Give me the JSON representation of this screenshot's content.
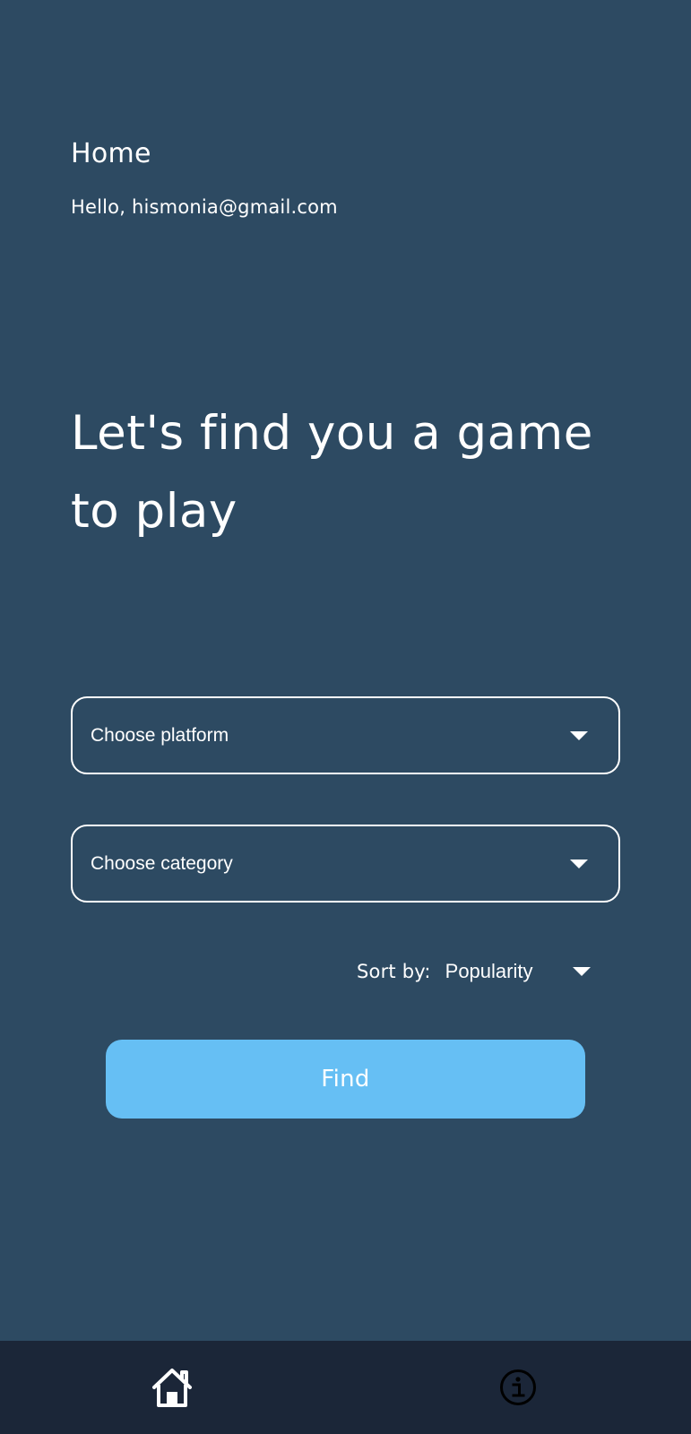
{
  "header": {
    "title": "Home",
    "greeting": "Hello, hismonia@gmail.com"
  },
  "hero": {
    "headline": "Let's find you a game to play"
  },
  "filters": {
    "platform_placeholder": "Choose platform",
    "category_placeholder": "Choose category",
    "sort_label": "Sort by:",
    "sort_value": "Popularity"
  },
  "actions": {
    "find_label": "Find"
  },
  "nav": {
    "items": [
      {
        "icon": "home-icon",
        "active": true
      },
      {
        "icon": "info-icon",
        "active": false
      }
    ]
  },
  "colors": {
    "background": "#2d4a62",
    "bottom_nav": "#1b2638",
    "button": "#66bff4",
    "text": "#ffffff",
    "info_icon": "#000000"
  }
}
